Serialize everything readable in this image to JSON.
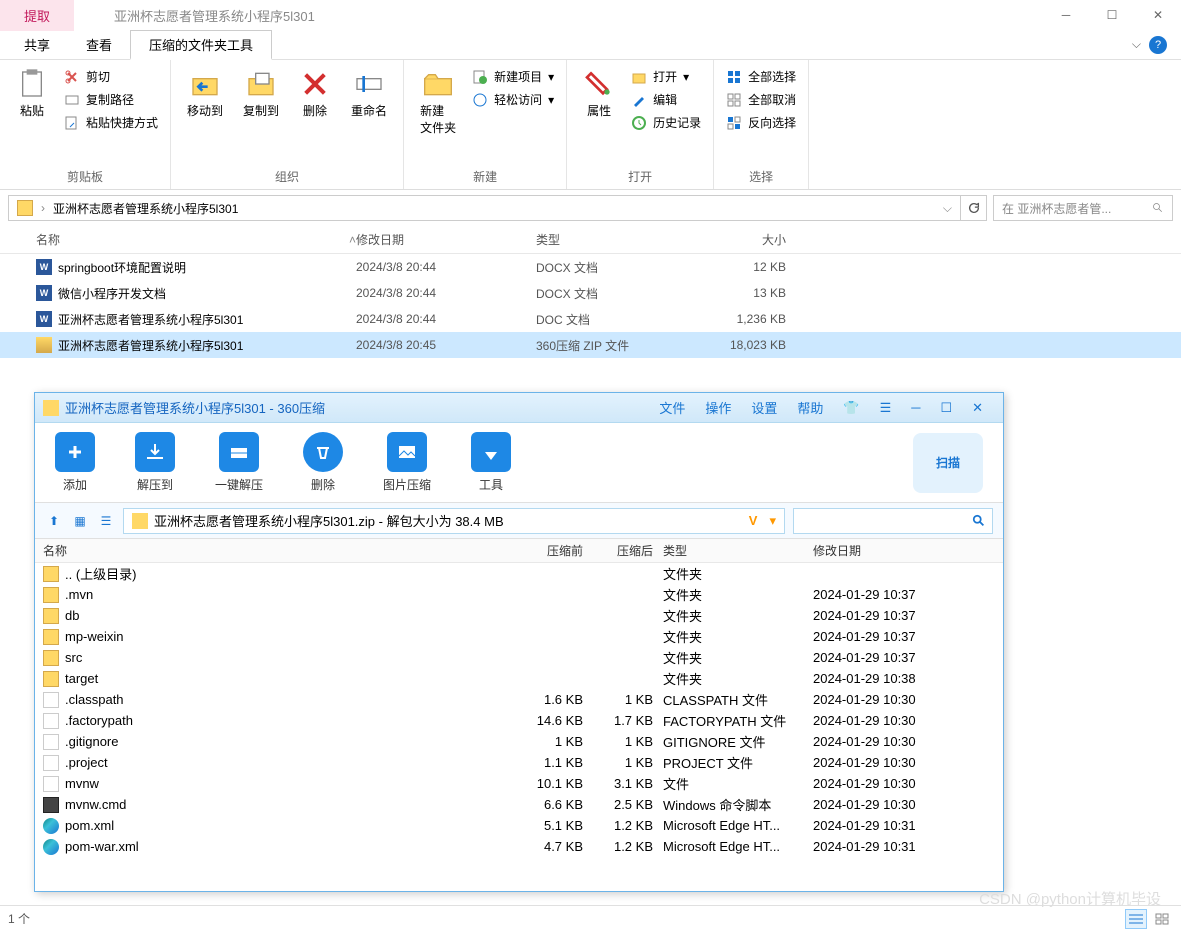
{
  "titlebar": {
    "tab": "提取",
    "title": "亚洲杯志愿者管理系统小程序5l301"
  },
  "menubar": {
    "items": [
      "共享",
      "查看",
      "压缩的文件夹工具"
    ]
  },
  "ribbon": {
    "clipboard": {
      "paste": "粘贴",
      "cut": "剪切",
      "copypath": "复制路径",
      "pasteshortcut": "粘贴快捷方式",
      "label": "剪贴板"
    },
    "organize": {
      "moveto": "移动到",
      "copyto": "复制到",
      "delete": "删除",
      "rename": "重命名",
      "label": "组织"
    },
    "new": {
      "newfolder": "新建\n文件夹",
      "newitem": "新建项目",
      "easyaccess": "轻松访问",
      "label": "新建"
    },
    "open": {
      "properties": "属性",
      "open": "打开",
      "edit": "编辑",
      "history": "历史记录",
      "label": "打开"
    },
    "select": {
      "selectall": "全部选择",
      "selectnone": "全部取消",
      "invert": "反向选择",
      "label": "选择"
    }
  },
  "address": {
    "path": "亚洲杯志愿者管理系统小程序5l301",
    "search_placeholder": "在 亚洲杯志愿者管..."
  },
  "columns": {
    "name": "名称",
    "date": "修改日期",
    "type": "类型",
    "size": "大小"
  },
  "files": [
    {
      "icon": "docx",
      "name": "springboot环境配置说明",
      "date": "2024/3/8 20:44",
      "type": "DOCX 文档",
      "size": "12 KB"
    },
    {
      "icon": "docx",
      "name": "微信小程序开发文档",
      "date": "2024/3/8 20:44",
      "type": "DOCX 文档",
      "size": "13 KB"
    },
    {
      "icon": "doc",
      "name": "亚洲杯志愿者管理系统小程序5l301",
      "date": "2024/3/8 20:44",
      "type": "DOC 文档",
      "size": "1,236 KB"
    },
    {
      "icon": "zip",
      "name": "亚洲杯志愿者管理系统小程序5l301",
      "date": "2024/3/8 20:45",
      "type": "360压缩 ZIP 文件",
      "size": "18,023 KB",
      "selected": true
    }
  ],
  "zipwin": {
    "title": "亚洲杯志愿者管理系统小程序5l301 - 360压缩",
    "menu": [
      "文件",
      "操作",
      "设置",
      "帮助"
    ],
    "toolbar": {
      "add": "添加",
      "extractto": "解压到",
      "oneclick": "一键解压",
      "delete": "删除",
      "imgcompress": "图片压缩",
      "tools": "工具",
      "scan": "扫描"
    },
    "path": "亚洲杯志愿者管理系统小程序5l301.zip - 解包大小为 38.4 MB",
    "columns": {
      "name": "名称",
      "before": "压缩前",
      "after": "压缩后",
      "type": "类型",
      "date": "修改日期"
    },
    "rows": [
      {
        "icon": "folder",
        "name": ".. (上级目录)",
        "before": "",
        "after": "",
        "type": "文件夹",
        "date": ""
      },
      {
        "icon": "folder",
        "name": ".mvn",
        "before": "",
        "after": "",
        "type": "文件夹",
        "date": "2024-01-29 10:37"
      },
      {
        "icon": "folder",
        "name": "db",
        "before": "",
        "after": "",
        "type": "文件夹",
        "date": "2024-01-29 10:37"
      },
      {
        "icon": "folder",
        "name": "mp-weixin",
        "before": "",
        "after": "",
        "type": "文件夹",
        "date": "2024-01-29 10:37"
      },
      {
        "icon": "folder",
        "name": "src",
        "before": "",
        "after": "",
        "type": "文件夹",
        "date": "2024-01-29 10:37"
      },
      {
        "icon": "folder",
        "name": "target",
        "before": "",
        "after": "",
        "type": "文件夹",
        "date": "2024-01-29 10:38"
      },
      {
        "icon": "file",
        "name": ".classpath",
        "before": "1.6 KB",
        "after": "1 KB",
        "type": "CLASSPATH 文件",
        "date": "2024-01-29 10:30"
      },
      {
        "icon": "file",
        "name": ".factorypath",
        "before": "14.6 KB",
        "after": "1.7 KB",
        "type": "FACTORYPATH 文件",
        "date": "2024-01-29 10:30"
      },
      {
        "icon": "file",
        "name": ".gitignore",
        "before": "1 KB",
        "after": "1 KB",
        "type": "GITIGNORE 文件",
        "date": "2024-01-29 10:30"
      },
      {
        "icon": "file",
        "name": ".project",
        "before": "1.1 KB",
        "after": "1 KB",
        "type": "PROJECT 文件",
        "date": "2024-01-29 10:30"
      },
      {
        "icon": "file",
        "name": "mvnw",
        "before": "10.1 KB",
        "after": "3.1 KB",
        "type": "文件",
        "date": "2024-01-29 10:30"
      },
      {
        "icon": "cmd",
        "name": "mvnw.cmd",
        "before": "6.6 KB",
        "after": "2.5 KB",
        "type": "Windows 命令脚本",
        "date": "2024-01-29 10:30"
      },
      {
        "icon": "edge",
        "name": "pom.xml",
        "before": "5.1 KB",
        "after": "1.2 KB",
        "type": "Microsoft Edge HT...",
        "date": "2024-01-29 10:31"
      },
      {
        "icon": "edge",
        "name": "pom-war.xml",
        "before": "4.7 KB",
        "after": "1.2 KB",
        "type": "Microsoft Edge HT...",
        "date": "2024-01-29 10:31"
      }
    ]
  },
  "status": {
    "left": "1 个"
  },
  "watermark": "CSDN @python计算机毕设"
}
